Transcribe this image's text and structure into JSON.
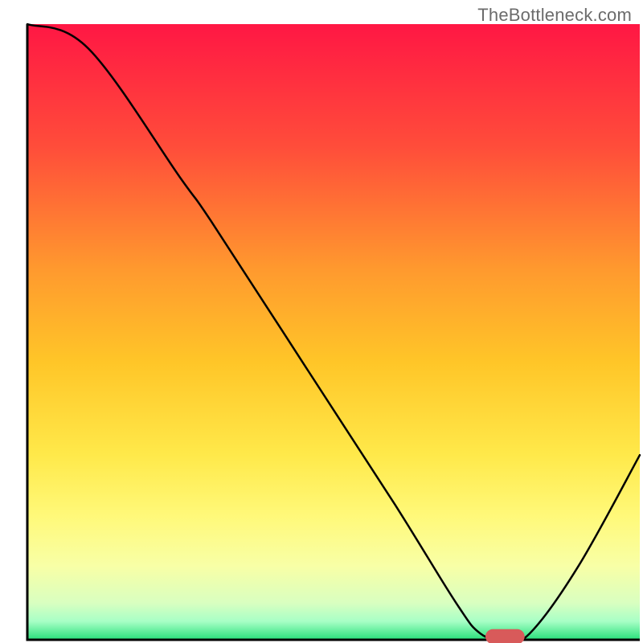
{
  "watermark": "TheBottleneck.com",
  "chart_data": {
    "type": "line",
    "title": "",
    "xlabel": "",
    "ylabel": "",
    "xlim": [
      0,
      100
    ],
    "ylim": [
      0,
      100
    ],
    "grid": false,
    "legend": false,
    "background_gradient_stops": [
      {
        "offset": 0,
        "color": "#ff1744"
      },
      {
        "offset": 20,
        "color": "#ff4d3a"
      },
      {
        "offset": 40,
        "color": "#ff9a2e"
      },
      {
        "offset": 55,
        "color": "#ffc628"
      },
      {
        "offset": 70,
        "color": "#ffe94a"
      },
      {
        "offset": 80,
        "color": "#fff97a"
      },
      {
        "offset": 88,
        "color": "#f8ffa6"
      },
      {
        "offset": 94,
        "color": "#d9ffc0"
      },
      {
        "offset": 97,
        "color": "#a8ffc6"
      },
      {
        "offset": 100,
        "color": "#28e07a"
      }
    ],
    "series": [
      {
        "name": "bottleneck-curve",
        "color": "#000000",
        "x": [
          0,
          10,
          25,
          30,
          45,
          60,
          70,
          74,
          78,
          82,
          90,
          100
        ],
        "y": [
          100,
          96,
          75,
          68,
          45,
          22,
          6,
          1,
          0,
          1,
          12,
          30
        ]
      }
    ],
    "marker": {
      "name": "optimal-point",
      "x": 78,
      "y": 0,
      "color": "#d85a5a",
      "rx": 3.2,
      "ry": 1.2
    },
    "frame": {
      "left": 4,
      "right": 100,
      "bottom": 0,
      "stroke": "#000000",
      "width": 3
    }
  }
}
